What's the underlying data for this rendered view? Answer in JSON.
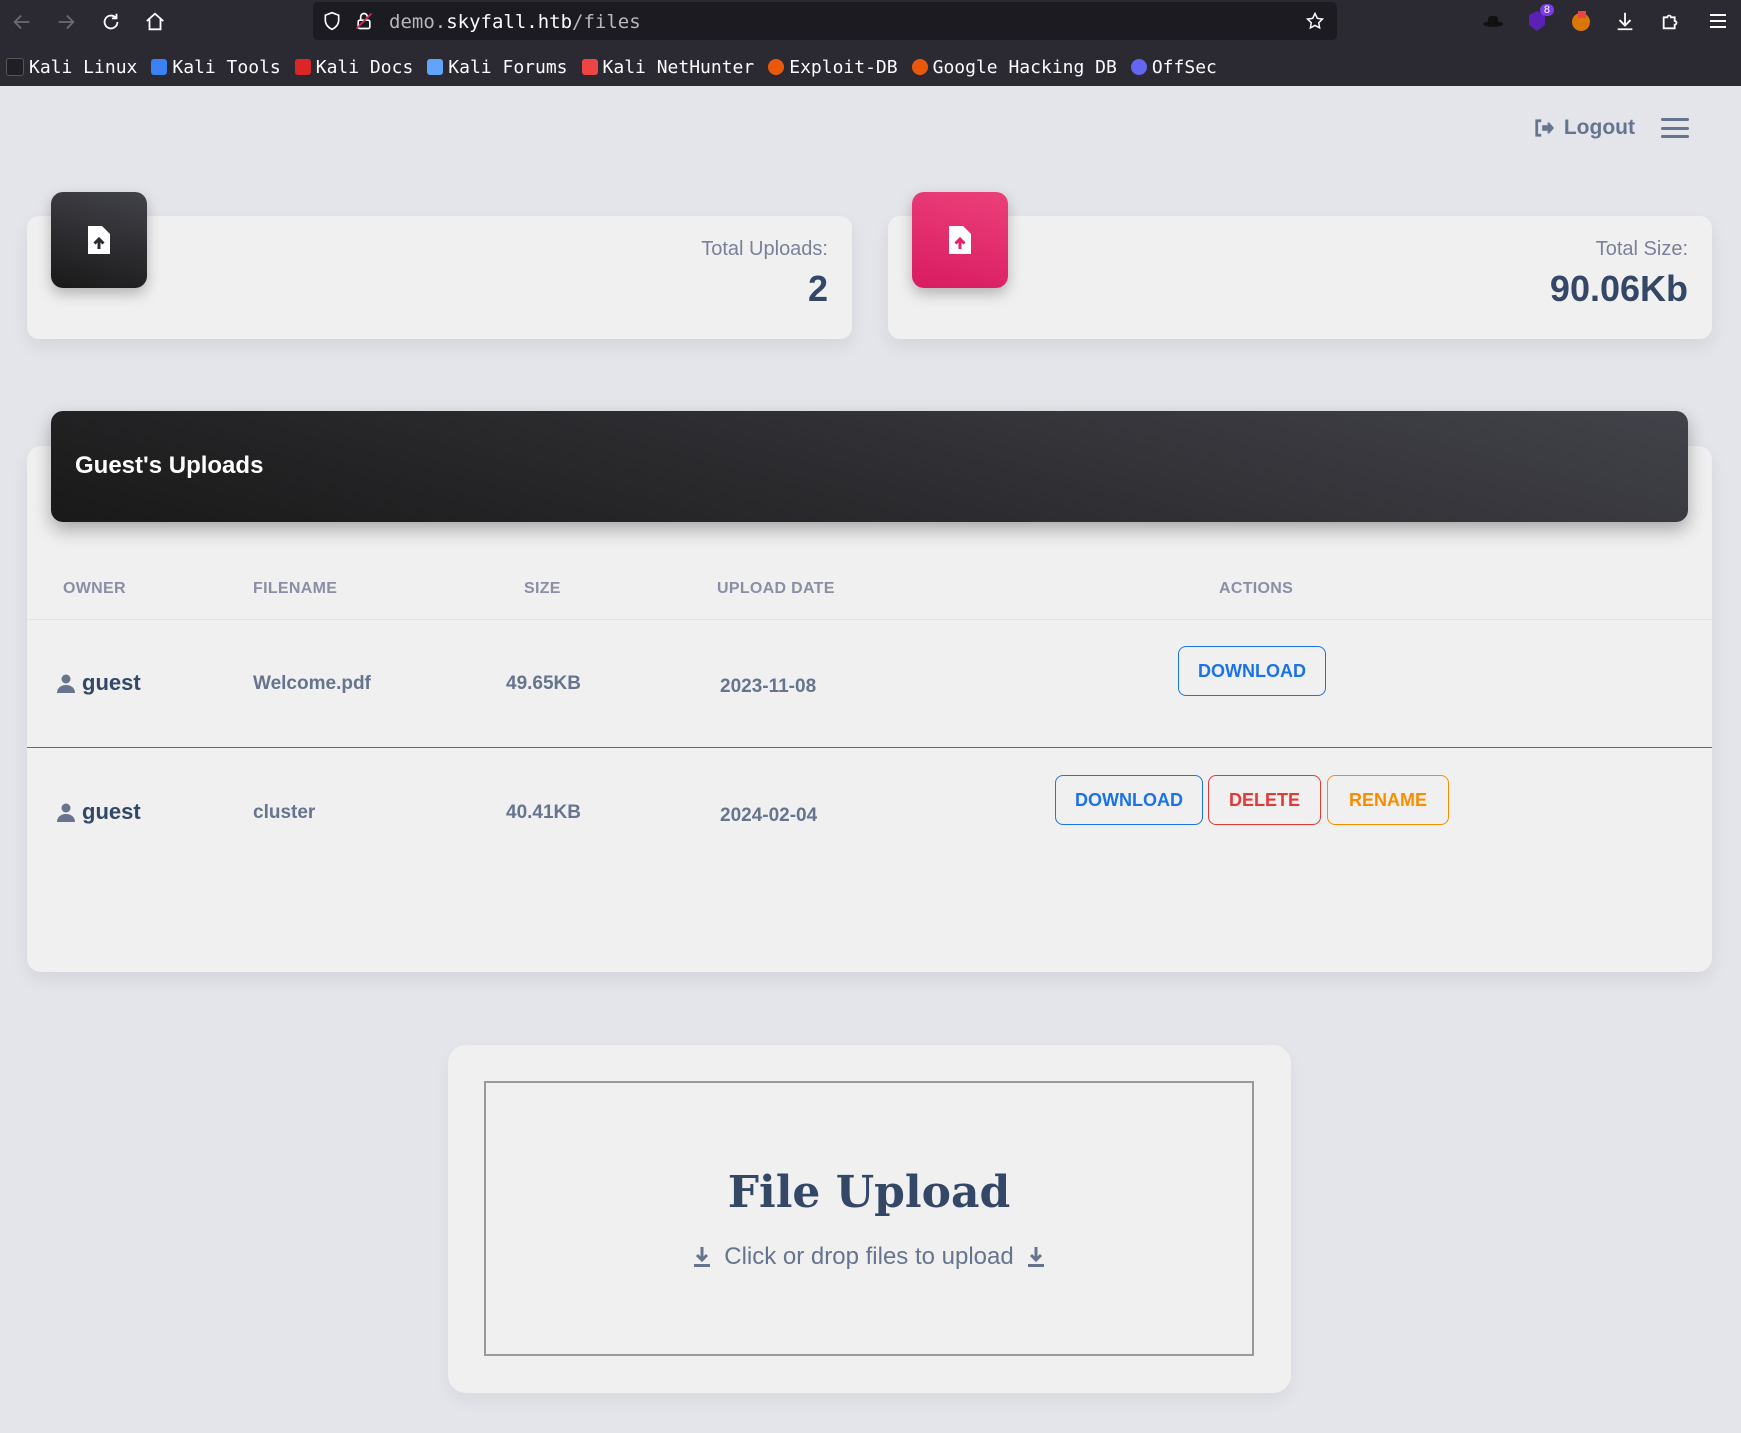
{
  "browser": {
    "url_prefix": "demo.",
    "url_host": "skyfall.htb",
    "url_path": "/files",
    "extension_badge": "8",
    "bookmarks": [
      {
        "label": "Kali Linux",
        "color": "#2b2a33"
      },
      {
        "label": "Kali Tools",
        "color": "#3b82f6"
      },
      {
        "label": "Kali Docs",
        "color": "#dc2626"
      },
      {
        "label": "Kali Forums",
        "color": "#60a5fa"
      },
      {
        "label": "Kali NetHunter",
        "color": "#ef4444"
      },
      {
        "label": "Exploit-DB",
        "color": "#ea580c"
      },
      {
        "label": "Google Hacking DB",
        "color": "#ea580c"
      },
      {
        "label": "OffSec",
        "color": "#6366f1"
      }
    ]
  },
  "topbar": {
    "logout_label": "Logout"
  },
  "stats": {
    "uploads_label": "Total Uploads:",
    "uploads_value": "2",
    "size_label": "Total Size:",
    "size_value": "90.06Kb"
  },
  "table": {
    "title": "Guest's Uploads",
    "headers": {
      "owner": "OWNER",
      "filename": "FILENAME",
      "size": "SIZE",
      "date": "UPLOAD DATE",
      "actions": "ACTIONS"
    },
    "rows": [
      {
        "owner": "guest",
        "filename": "Welcome.pdf",
        "size": "49.65KB",
        "date": "2023-11-08",
        "download": "DOWNLOAD"
      },
      {
        "owner": "guest",
        "filename": "cluster",
        "size": "40.41KB",
        "date": "2024-02-04",
        "download": "DOWNLOAD",
        "delete": "DELETE",
        "rename": "RENAME"
      }
    ]
  },
  "upload": {
    "title": "File Upload",
    "subtitle": "Click or drop files to upload"
  },
  "colors": {
    "accent_blue": "#1a73e8",
    "danger": "#e53935",
    "warning": "#fb8c00",
    "pink": "#e91e63"
  }
}
